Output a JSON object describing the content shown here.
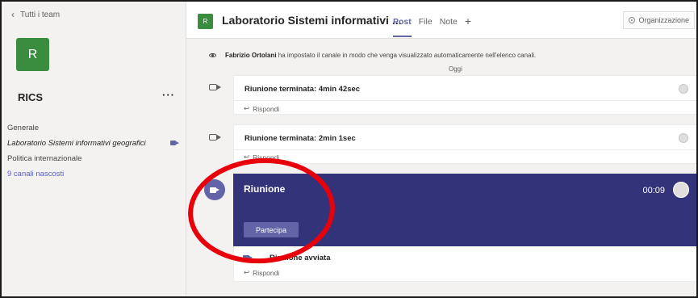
{
  "sidebar": {
    "back_label": "Tutti i team",
    "team_initial": "R",
    "team_name": "RICS",
    "more": "···",
    "channels": [
      {
        "label": "Generale"
      },
      {
        "label": "Laboratorio Sistemi informativi geografici"
      },
      {
        "label": "Politica internazionale"
      },
      {
        "label": "9 canali nascosti"
      }
    ]
  },
  "header": {
    "channel_initial": "R",
    "title": "Laboratorio Sistemi informativi ...",
    "tabs": [
      "Post",
      "File",
      "Note"
    ],
    "add": "+",
    "org_label": "Organizzazione"
  },
  "feed": {
    "notice_author": "Fabrizio Ortolani",
    "notice_text": " ha impostato il canale in modo che venga visualizzato automaticamente nell'elenco canali.",
    "date_separator": "Oggi",
    "posts": [
      {
        "title": "Riunione terminata: 4min 42sec",
        "reply": "Rispondi"
      },
      {
        "title": "Riunione terminata: 2min 1sec",
        "reply": "Rispondi"
      }
    ],
    "meeting": {
      "title": "Riunione",
      "timer": "00:09",
      "join_label": "Partecipa",
      "status": "Riunione avviata",
      "reply": "Rispondi"
    }
  },
  "colors": {
    "accent": "#6264a7",
    "meeting_bg": "#33337a",
    "team_green": "#3a8c3f",
    "annotation_red": "#e8000b"
  }
}
